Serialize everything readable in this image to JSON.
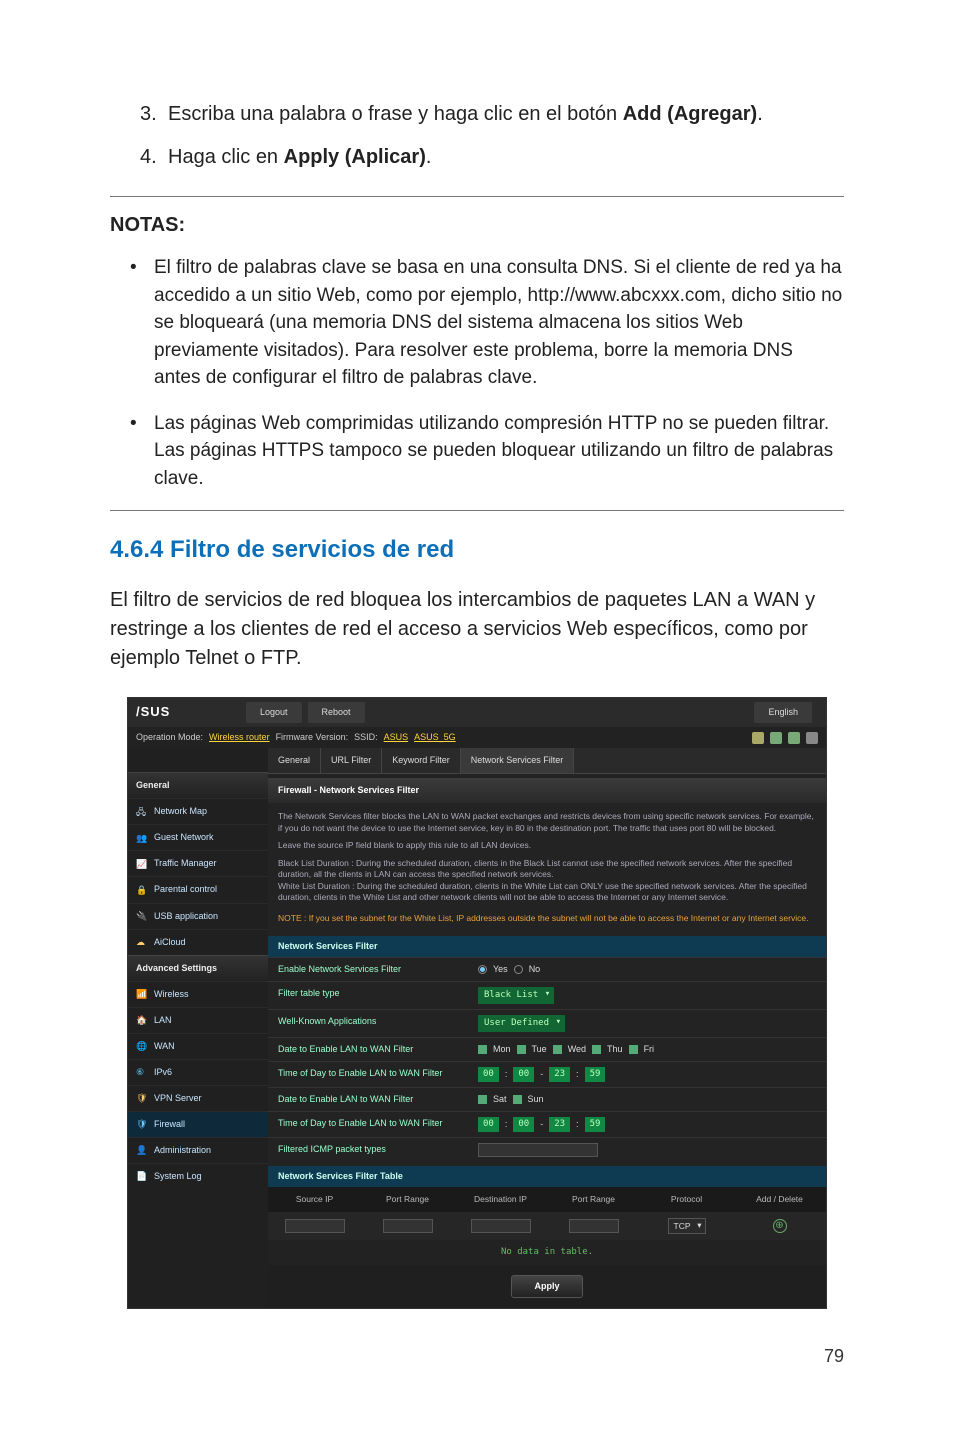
{
  "instructions": [
    {
      "num": "3.",
      "prefix": "Escriba una palabra o frase y haga clic en el botón ",
      "bold": "Add (Agregar)",
      "suffix": "."
    },
    {
      "num": "4.",
      "prefix": "Haga clic en ",
      "bold": "Apply (Aplicar)",
      "suffix": "."
    }
  ],
  "notas_title": "NOTAS:",
  "notas_bullets": [
    "El filtro de palabras clave se basa en una consulta DNS. Si el cliente de red ya ha accedido a un sitio Web, como por ejemplo, http://www.abcxxx.com, dicho sitio no se bloqueará (una memoria DNS del sistema almacena los sitios Web previamente visitados). Para resolver este problema, borre la memoria DNS antes de configurar el filtro de palabras clave.",
    "Las páginas Web comprimidas utilizando compresión HTTP no se pueden filtrar. Las páginas HTTPS tampoco se pueden bloquear utilizando un filtro de palabras clave."
  ],
  "section_title": "4.6.4 Filtro de servicios de red",
  "section_body": "El filtro de servicios de red bloquea los intercambios de paquetes LAN a WAN y restringe a los clientes de red el acceso a servicios Web específicos, como por ejemplo Telnet o FTP.",
  "router": {
    "brand": "/SUS",
    "topbar": {
      "logout": "Logout",
      "reboot": "Reboot",
      "language": "English"
    },
    "status": {
      "op_mode_label": "Operation Mode:",
      "op_mode_value": "Wireless router",
      "fw_label": "Firmware Version:",
      "ssid_label": "SSID:",
      "ssid1": "ASUS",
      "ssid2": "ASUS_5G"
    },
    "tabs": [
      "General",
      "URL Filter",
      "Keyword Filter",
      "Network Services Filter"
    ],
    "active_tab": 3,
    "sidebar_general_label": "General",
    "sidebar_general": [
      "Network Map",
      "Guest Network",
      "Traffic Manager",
      "Parental control",
      "USB application",
      "AiCloud"
    ],
    "sidebar_adv_label": "Advanced Settings",
    "sidebar_advanced": [
      "Wireless",
      "LAN",
      "WAN",
      "IPv6",
      "VPN Server",
      "Firewall",
      "Administration",
      "System Log"
    ],
    "sidebar_active": "Firewall",
    "panel_title": "Firewall - Network Services Filter",
    "desc_lines": [
      "The Network Services filter blocks the LAN to WAN packet exchanges and restricts devices from using specific network services. For example, if you do not want the device to use the Internet service, key in 80 in the destination port. The traffic that uses port 80 will be blocked.",
      "Leave the source IP field blank to apply this rule to all LAN devices.",
      "Black List Duration : During the scheduled duration, clients in the Black List cannot use the specified network services. After the specified duration, all the clients in LAN can access the specified network services.",
      "White List Duration : During the scheduled duration, clients in the White List can ONLY use the specified network services. After the specified duration, clients in the White List and other network clients will not be able to access the Internet or any Internet service."
    ],
    "warn": "NOTE : If you set the subnet for the White List, IP addresses outside the subnet will not be able to access the Internet or any Internet service.",
    "form_header": "Network Services Filter",
    "form": {
      "enable_label": "Enable Network Services Filter",
      "enable_yes": "Yes",
      "enable_no": "No",
      "tabletype_label": "Filter table type",
      "tabletype_value": "Black List",
      "wellknown_label": "Well-Known Applications",
      "wellknown_value": "User Defined",
      "date1_label": "Date to Enable LAN to WAN Filter",
      "days1": [
        "Mon",
        "Tue",
        "Wed",
        "Thu",
        "Fri"
      ],
      "time1_label": "Time of Day to Enable LAN to WAN Filter",
      "time1": [
        "00",
        "00",
        "23",
        "59"
      ],
      "date2_label": "Date to Enable LAN to WAN Filter",
      "days2": [
        "Sat",
        "Sun"
      ],
      "time2_label": "Time of Day to Enable LAN to WAN Filter",
      "time2": [
        "00",
        "00",
        "23",
        "59"
      ],
      "icmp_label": "Filtered ICMP packet types"
    },
    "table_header": "Network Services Filter Table",
    "table_cols": [
      "Source IP",
      "Port Range",
      "Destination IP",
      "Port Range",
      "Protocol",
      "Add / Delete"
    ],
    "protocol_value": "TCP",
    "nodata": "No data in table.",
    "apply": "Apply"
  },
  "page_number": "79"
}
